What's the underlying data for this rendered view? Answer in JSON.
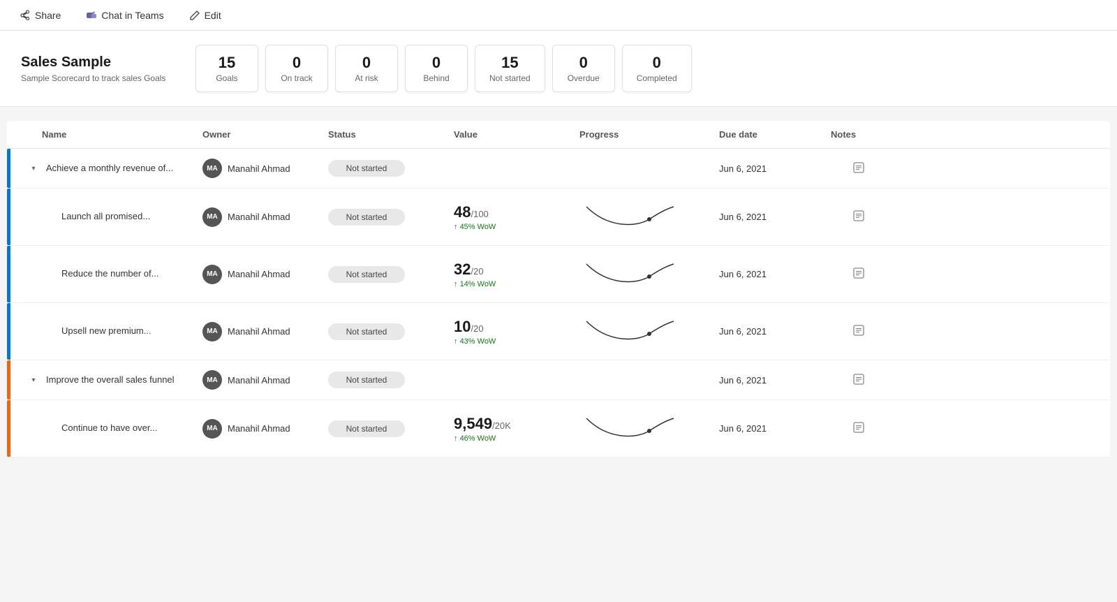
{
  "toolbar": {
    "share_label": "Share",
    "chat_label": "Chat in Teams",
    "edit_label": "Edit"
  },
  "scorecard": {
    "title": "Sales Sample",
    "subtitle": "Sample Scorecard to track sales Goals",
    "stats": [
      {
        "value": "15",
        "label": "Goals"
      },
      {
        "value": "0",
        "label": "On track"
      },
      {
        "value": "0",
        "label": "At risk"
      },
      {
        "value": "0",
        "label": "Behind"
      },
      {
        "value": "15",
        "label": "Not started"
      },
      {
        "value": "0",
        "label": "Overdue"
      },
      {
        "value": "0",
        "label": "Completed"
      }
    ]
  },
  "table": {
    "columns": {
      "name": "Name",
      "owner": "Owner",
      "status": "Status",
      "value": "Value",
      "progress": "Progress",
      "duedate": "Due date",
      "notes": "Notes"
    },
    "rows": [
      {
        "id": "row1",
        "indent": false,
        "expandable": true,
        "expanded": true,
        "indicator": "blue",
        "name": "Achieve a monthly revenue of...",
        "owner": "Manahil Ahmad",
        "owner_initials": "MA",
        "status": "Not started",
        "value_main": "",
        "value_denom": "",
        "value_wow": "",
        "has_chart": false,
        "duedate": "Jun 6, 2021",
        "has_notes": true
      },
      {
        "id": "row2",
        "indent": true,
        "expandable": false,
        "expanded": false,
        "indicator": "blue",
        "name": "Launch all promised...",
        "owner": "Manahil Ahmad",
        "owner_initials": "MA",
        "status": "Not started",
        "value_main": "48",
        "value_denom": "/100",
        "value_wow": "45% WoW",
        "has_chart": true,
        "duedate": "Jun 6, 2021",
        "has_notes": true
      },
      {
        "id": "row3",
        "indent": true,
        "expandable": false,
        "expanded": false,
        "indicator": "blue",
        "name": "Reduce the number of...",
        "owner": "Manahil Ahmad",
        "owner_initials": "MA",
        "status": "Not started",
        "value_main": "32",
        "value_denom": "/20",
        "value_wow": "14% WoW",
        "has_chart": true,
        "duedate": "Jun 6, 2021",
        "has_notes": true
      },
      {
        "id": "row4",
        "indent": true,
        "expandable": false,
        "expanded": false,
        "indicator": "blue",
        "name": "Upsell new premium...",
        "owner": "Manahil Ahmad",
        "owner_initials": "MA",
        "status": "Not started",
        "value_main": "10",
        "value_denom": "/20",
        "value_wow": "43% WoW",
        "has_chart": true,
        "duedate": "Jun 6, 2021",
        "has_notes": true
      },
      {
        "id": "row5",
        "indent": false,
        "expandable": true,
        "expanded": true,
        "indicator": "orange",
        "name": "Improve the overall sales funnel",
        "owner": "Manahil Ahmad",
        "owner_initials": "MA",
        "status": "Not started",
        "value_main": "",
        "value_denom": "",
        "value_wow": "",
        "has_chart": false,
        "duedate": "Jun 6, 2021",
        "has_notes": true
      },
      {
        "id": "row6",
        "indent": true,
        "expandable": false,
        "expanded": false,
        "indicator": "orange",
        "name": "Continue to have over...",
        "owner": "Manahil Ahmad",
        "owner_initials": "MA",
        "status": "Not started",
        "value_main": "9,549",
        "value_denom": "/20K",
        "value_wow": "46% WoW",
        "has_chart": true,
        "duedate": "Jun 6, 2021",
        "has_notes": true
      }
    ]
  }
}
